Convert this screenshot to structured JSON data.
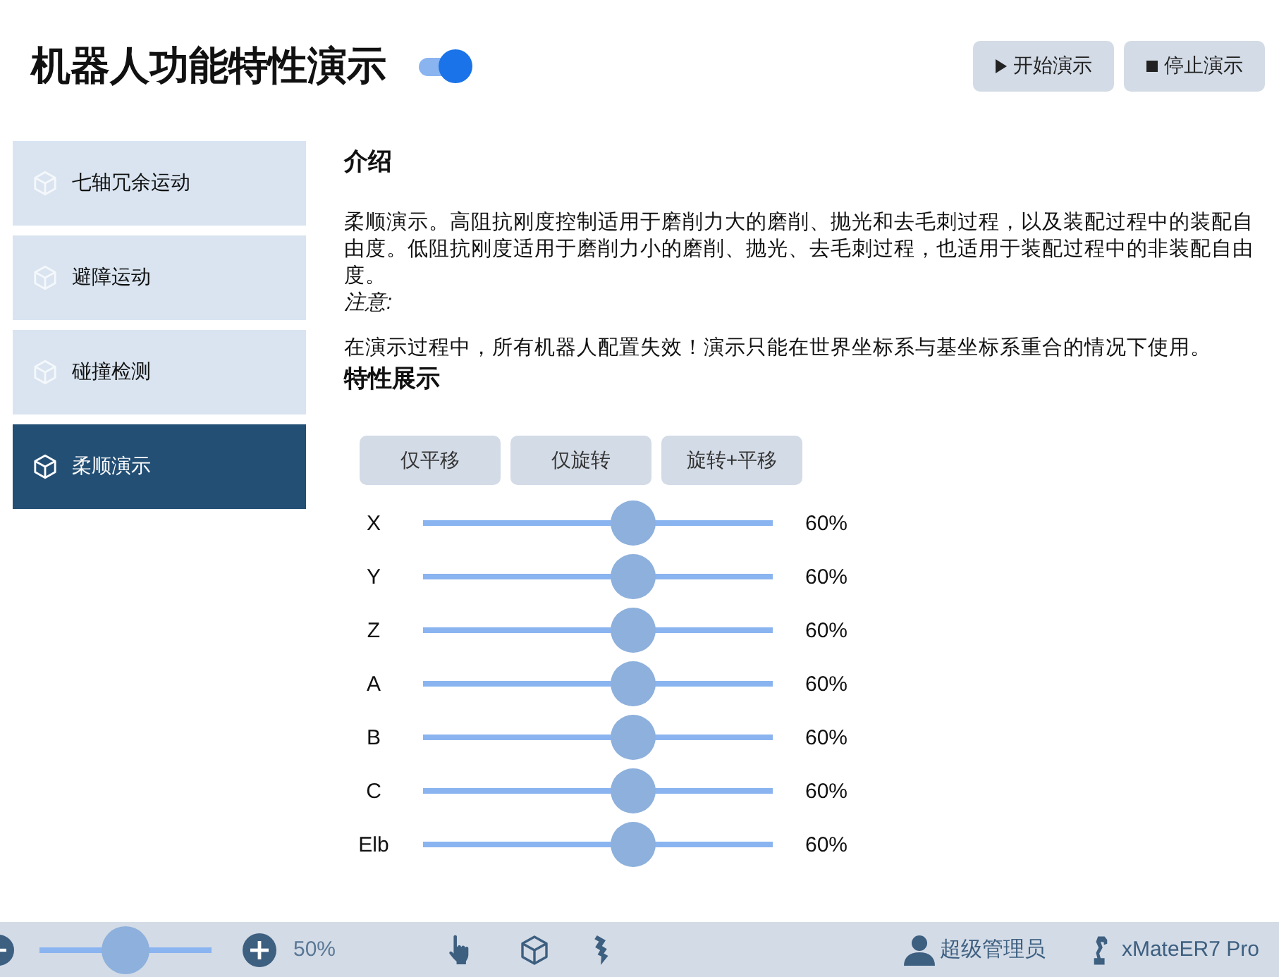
{
  "header": {
    "title": "机器人功能特性演示",
    "toggle": {
      "on": true
    },
    "buttons": [
      {
        "kind": "play",
        "label": "开始演示"
      },
      {
        "kind": "stop",
        "label": "停止演示"
      }
    ]
  },
  "sidebar": {
    "items": [
      {
        "label": "七轴冗余运动",
        "selected": false
      },
      {
        "label": "避障运动",
        "selected": false
      },
      {
        "label": "碰撞检测",
        "selected": false
      },
      {
        "label": "柔顺演示",
        "selected": true
      }
    ]
  },
  "content": {
    "intro_heading": "介绍",
    "intro_text": "柔顺演示。高阻抗刚度控制适用于磨削力大的磨削、抛光和去毛刺过程，以及装配过程中的装配自由度。低阻抗刚度适用于磨削力小的磨削、抛光、去毛刺过程，也适用于装配过程中的非装配自由度。",
    "note_label": "注意:",
    "note_text": "在演示过程中，所有机器人配置失效！演示只能在世界坐标系与基坐标系重合的情况下使用。",
    "features_heading": "特性展示",
    "mode_buttons": [
      {
        "label": "仅平移"
      },
      {
        "label": "仅旋转"
      },
      {
        "label": "旋转+平移"
      }
    ],
    "sliders": [
      {
        "label": "X",
        "level": 0.6,
        "reading": "60%"
      },
      {
        "label": "Y",
        "level": 0.6,
        "reading": "60%"
      },
      {
        "label": "Z",
        "level": 0.6,
        "reading": "60%"
      },
      {
        "label": "A",
        "level": 0.6,
        "reading": "60%"
      },
      {
        "label": "B",
        "level": 0.6,
        "reading": "60%"
      },
      {
        "label": "C",
        "level": 0.6,
        "reading": "60%"
      },
      {
        "label": "Elb",
        "level": 0.6,
        "reading": "60%"
      }
    ]
  },
  "status_bar": {
    "zoom": {
      "level": 0.5,
      "reading": "50%"
    },
    "user": "超级管理员",
    "robot": "xMateER7 Pro"
  }
}
